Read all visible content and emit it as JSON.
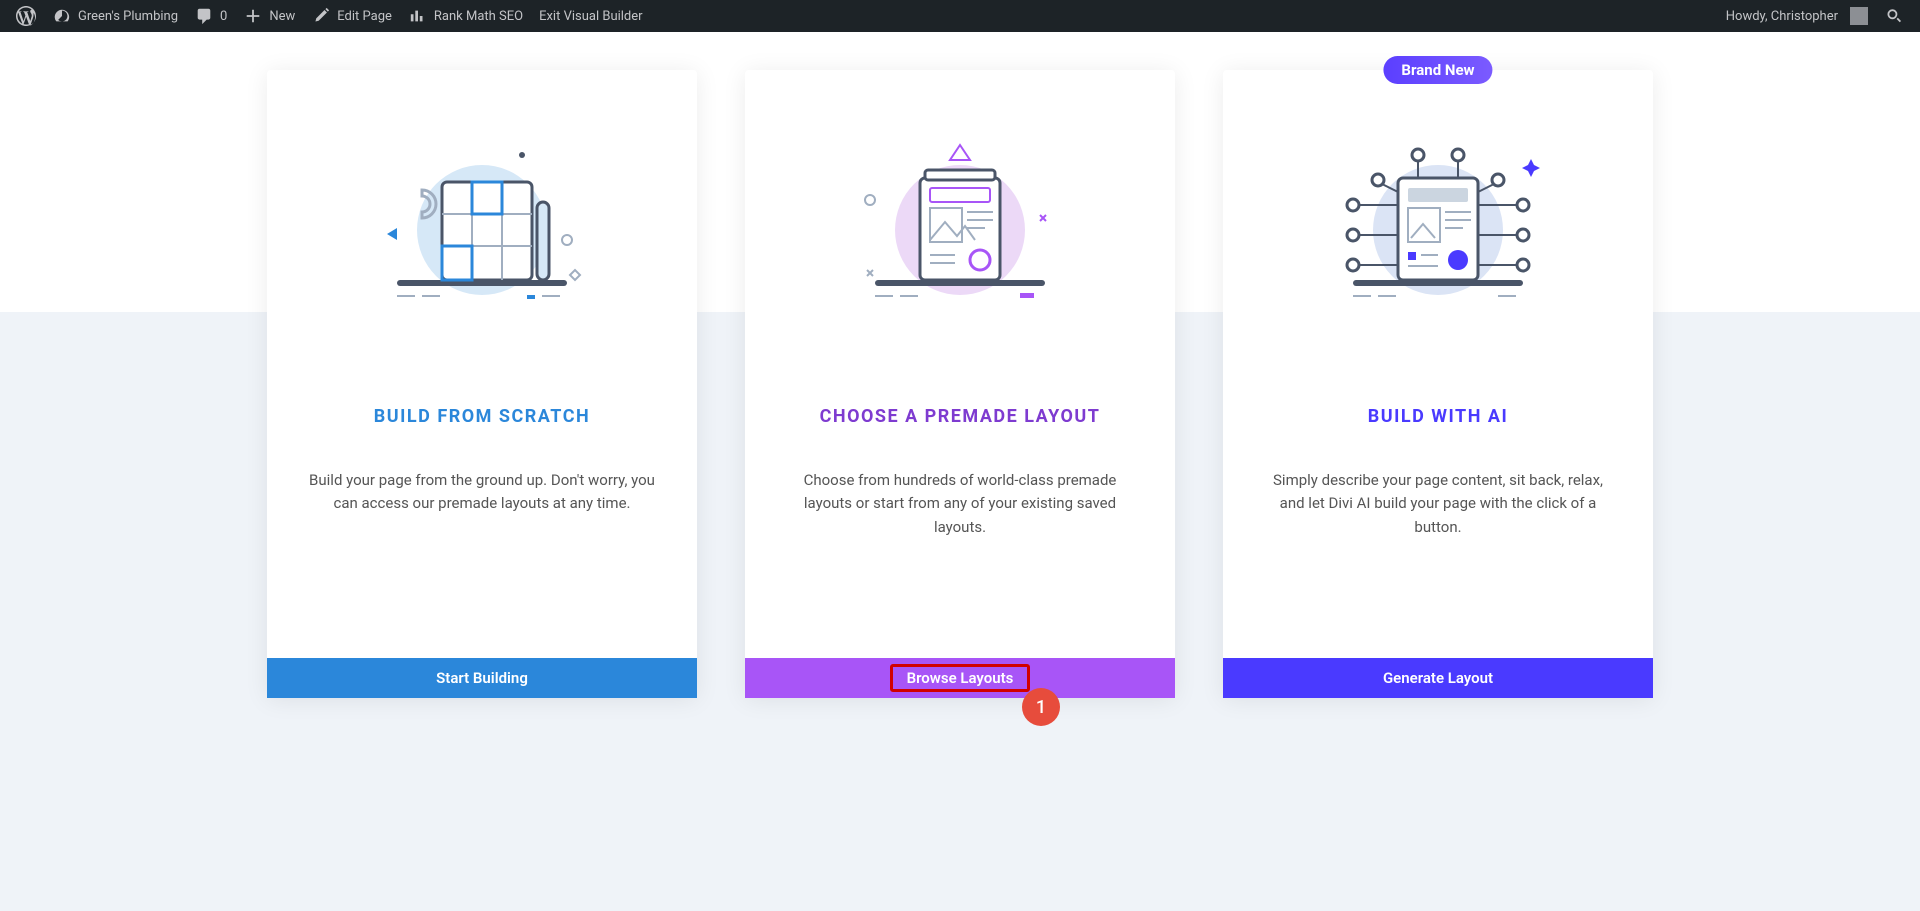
{
  "adminBar": {
    "siteName": "Green's Plumbing",
    "commentCount": "0",
    "newLabel": "New",
    "editPageLabel": "Edit Page",
    "rankMathLabel": "Rank Math SEO",
    "exitBuilderLabel": "Exit Visual Builder",
    "greeting": "Howdy, Christopher"
  },
  "cards": {
    "scratch": {
      "title": "BUILD FROM SCRATCH",
      "description": "Build your page from the ground up. Don't worry, you can access our premade layouts at any time.",
      "button": "Start Building"
    },
    "premade": {
      "title": "CHOOSE A PREMADE LAYOUT",
      "description": "Choose from hundreds of world-class premade layouts or start from any of your existing saved layouts.",
      "button": "Browse Layouts"
    },
    "ai": {
      "badge": "Brand New",
      "title": "BUILD WITH AI",
      "description": "Simply describe your page content, sit back, relax, and let Divi AI build your page with the click of a button.",
      "button": "Generate Layout"
    }
  },
  "annotation": {
    "number": "1"
  }
}
